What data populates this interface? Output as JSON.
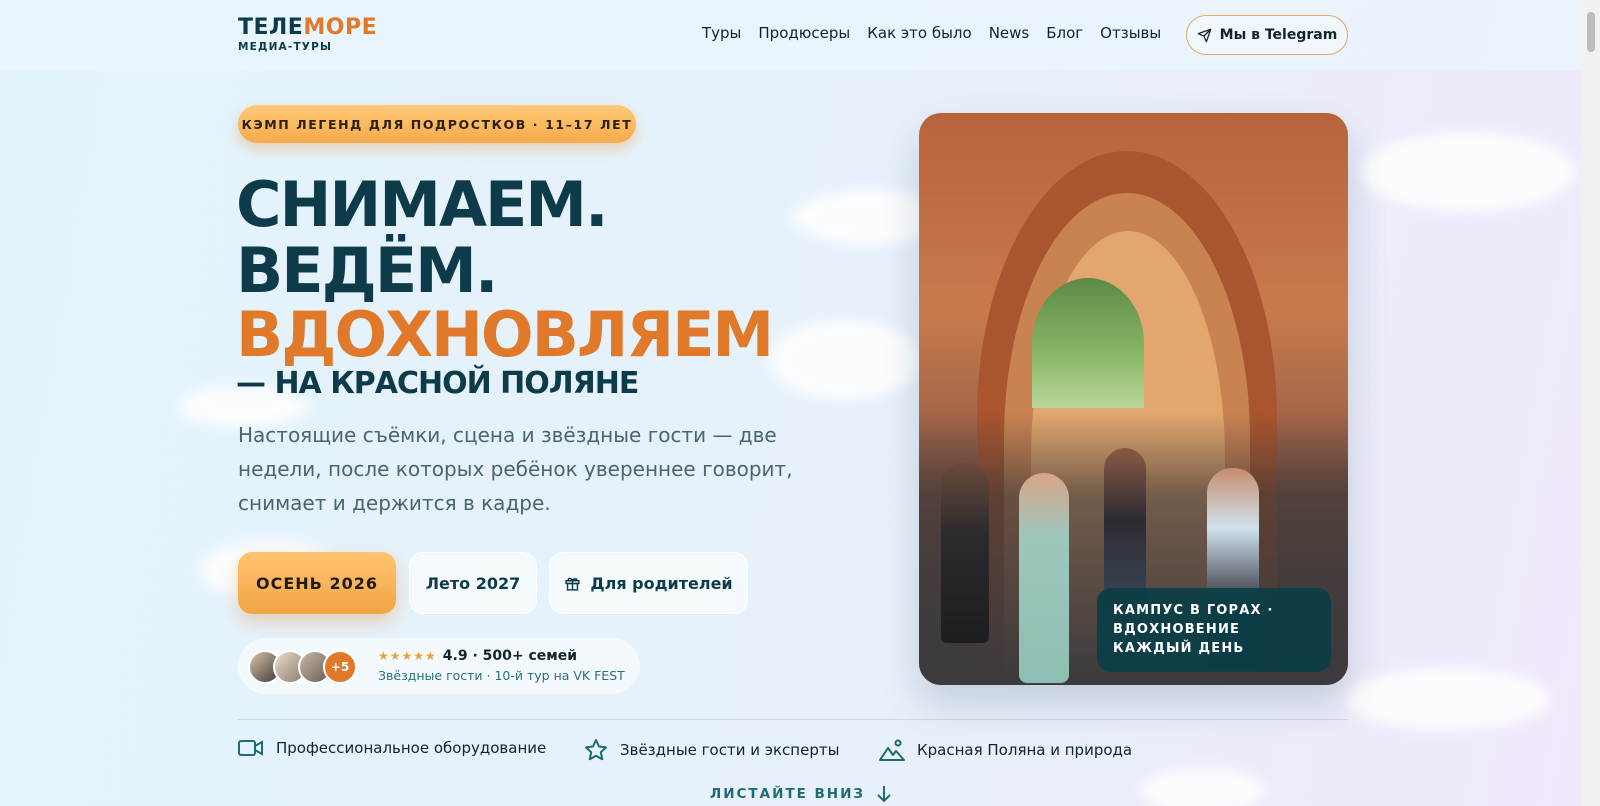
{
  "brand": {
    "name_part1": "ТЕЛЕ",
    "name_part2": "МОРЕ",
    "subtitle": "МЕДИА-ТУРЫ"
  },
  "nav": {
    "items": [
      {
        "label": "Туры"
      },
      {
        "label": "Продюсеры"
      },
      {
        "label": "Как это было"
      },
      {
        "label": "News"
      },
      {
        "label": "Блог"
      },
      {
        "label": "Отзывы"
      }
    ],
    "telegram_button": {
      "label": "Мы в Telegram",
      "icon": "paper-plane-icon"
    }
  },
  "hero": {
    "badge": "КЭМП ЛЕГЕНД ДЛЯ ПОДРОСТКОВ · 11–17 ЛЕТ",
    "headline_line1": "СНИМАЕМ.",
    "headline_line2": "ВЕДЁМ.",
    "headline_line3": "ВДОХНОВЛЯЕМ",
    "headline_line4": "— НА КРАСНОЙ ПОЛЯНЕ",
    "lead": "Настоящие съёмки, сцена и звёздные гости — две недели, после которых ребёнок увереннее говорит, снимает и держится в кадре.",
    "buttons": {
      "primary": "ОСЕНЬ 2026",
      "secondary": "Лето 2027",
      "parents": "Для родителей",
      "parents_icon": "gift-icon"
    },
    "rating": {
      "avatars_extra": "+5",
      "stars": "★★★★★",
      "score_text": "4.9 · 500+ семей",
      "subtext": "Звёздные гости · 10-й тур на VK FEST",
      "star_rating": 5
    }
  },
  "photo": {
    "caption": "КАМПУС В ГОРАХ · ВДОХНОВЕНИЕ КАЖДЫЙ ДЕНЬ"
  },
  "features": [
    {
      "label": "Профессиональное оборудование",
      "icon": "video-camera-icon"
    },
    {
      "label": "Звёздные гости и эксперты",
      "icon": "star-icon"
    },
    {
      "label": "Красная Поляна и природа",
      "icon": "mountain-icon"
    }
  ],
  "scroll_hint": {
    "label": "ЛИСТАЙТЕ ВНИЗ",
    "icon": "arrow-down-icon"
  },
  "colors": {
    "primary_dark": "#0d3b4a",
    "accent_orange": "#e07a2a",
    "button_gradient_top": "#ffc472",
    "teal": "#1f6b73"
  }
}
